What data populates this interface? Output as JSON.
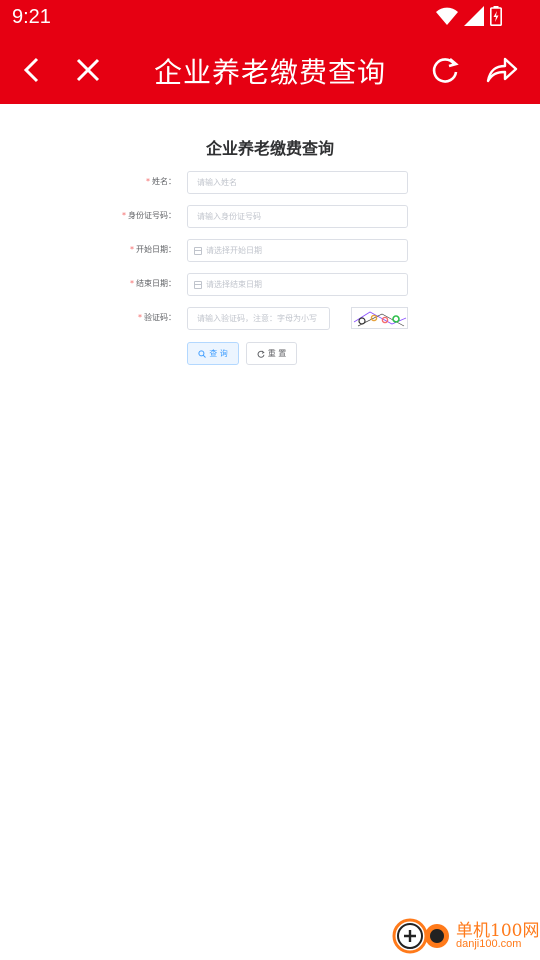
{
  "status_bar": {
    "time": "9:21"
  },
  "app_bar": {
    "title": "企业养老缴费查询"
  },
  "form": {
    "title": "企业养老缴费查询",
    "fields": [
      {
        "label": "姓名：",
        "placeholder": "请输入姓名"
      },
      {
        "label": "身份证号码：",
        "placeholder": "请输入身份证号码"
      },
      {
        "label": "开始日期：",
        "placeholder": "请选择开始日期"
      },
      {
        "label": "结束日期：",
        "placeholder": "请选择结束日期"
      },
      {
        "label": "验证码：",
        "placeholder": "请输入验证码，注意：字母为小写"
      }
    ],
    "required_mark": "*",
    "query_label": "查 询",
    "reset_label": "重 置"
  },
  "watermark": {
    "name": "单机100网",
    "url": "danji100.com"
  },
  "colors": {
    "accent": "#e60012",
    "primary": "#409eff",
    "required": "#f56c6c",
    "brand": "#ff7a1a"
  }
}
